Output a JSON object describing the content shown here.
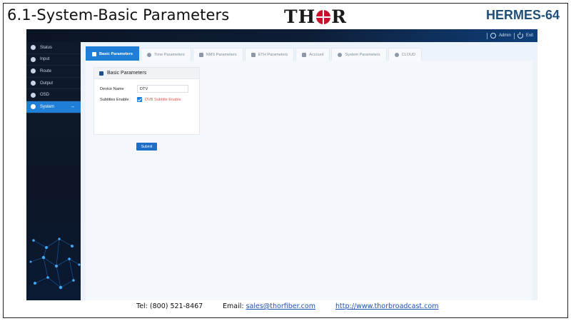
{
  "slide": {
    "title": "6.1-System-Basic Parameters",
    "logo_text_left": "TH",
    "logo_text_right": "R",
    "product": "HERMES-64"
  },
  "topbar": {
    "user_label": "Admin",
    "exit_label": "Exit"
  },
  "sidebar": {
    "items": [
      {
        "label": "Status",
        "icon": "status-icon"
      },
      {
        "label": "Input",
        "icon": "input-icon"
      },
      {
        "label": "Route",
        "icon": "route-icon"
      },
      {
        "label": "Output",
        "icon": "output-icon"
      },
      {
        "label": "OSD",
        "icon": "osd-icon"
      },
      {
        "label": "System",
        "icon": "system-icon",
        "active": true
      }
    ],
    "active_arrow": "→"
  },
  "tabs": [
    {
      "label": "Basic Parameters",
      "icon": "tools-icon",
      "active": true
    },
    {
      "label": "Time Parameters",
      "icon": "clock-icon"
    },
    {
      "label": "NMS Parameters",
      "icon": "network-icon"
    },
    {
      "label": "ETH Parameters",
      "icon": "ethernet-icon"
    },
    {
      "label": "Account",
      "icon": "key-icon"
    },
    {
      "label": "System Parameters",
      "icon": "gear-icon"
    },
    {
      "label": "CLOUD",
      "icon": "cloud-icon"
    }
  ],
  "panel": {
    "title": "Basic Parameters",
    "device_name_label": "Device Name",
    "device_name_value": "DTV",
    "subtitles_label": "Subtitles Enable",
    "subtitles_checkbox_label": "DVB Subtitle Enable",
    "subtitles_checked": true
  },
  "submit_label": "Submit",
  "footer": {
    "tel": "Tel: (800) 521-8467",
    "email_prefix": "Email: ",
    "email": "sales@thorfiber.com",
    "website": "http://www.thorbroadcast.com"
  },
  "colors": {
    "accent": "#1f7fd6",
    "product_text": "#1f4e79",
    "logo_red": "#c8102e",
    "checkbox_label": "#e0534f"
  }
}
